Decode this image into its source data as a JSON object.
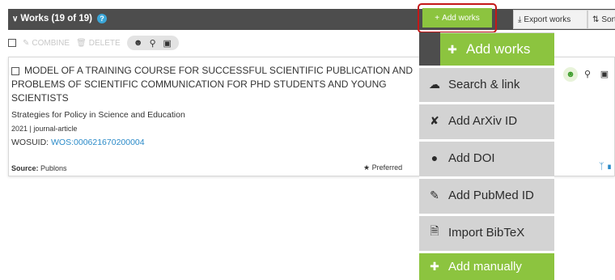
{
  "header": {
    "title": "Works (19 of 19)",
    "help": "?",
    "add_works_label": "Add works",
    "export_label": "Export works",
    "sort_label": "Sort"
  },
  "toolbar": {
    "combine_label": "COMBINE",
    "delete_label": "DELETE"
  },
  "record": {
    "title": "MODEL OF A TRAINING COURSE FOR SUCCESSFUL SCIENTIFIC PUBLICATION AND PROBLEMS OF SCIENTIFIC COMMUNICATION FOR PHD STUDENTS AND YOUNG SCIENTISTS",
    "journal": "Strategies for Policy in Science and Education",
    "meta": "2021 | journal-article",
    "wosuid_label": "WOSUID:",
    "wosuid_value": "WOS:000621670200004",
    "source_label": "Source:",
    "source_value": "Publons",
    "preferred_label": "★ Preferred"
  },
  "dropdown": {
    "items": [
      {
        "label": "Add works",
        "icon": "plus-icon"
      },
      {
        "label": "Search & link",
        "icon": "cloud-upload-icon"
      },
      {
        "label": "Add ArXiv ID",
        "icon": "arxiv-icon"
      },
      {
        "label": "Add DOI",
        "icon": "doi-icon"
      },
      {
        "label": "Add PubMed ID",
        "icon": "pubmed-icon"
      },
      {
        "label": "Import BibTeX",
        "icon": "import-icon"
      },
      {
        "label": "Add manually",
        "icon": "plus-icon"
      }
    ]
  },
  "colors": {
    "accent_green": "#8cc43f",
    "header_dark": "#4d4d4d",
    "link_blue": "#2a8ac8",
    "highlight_red": "#c41818"
  }
}
